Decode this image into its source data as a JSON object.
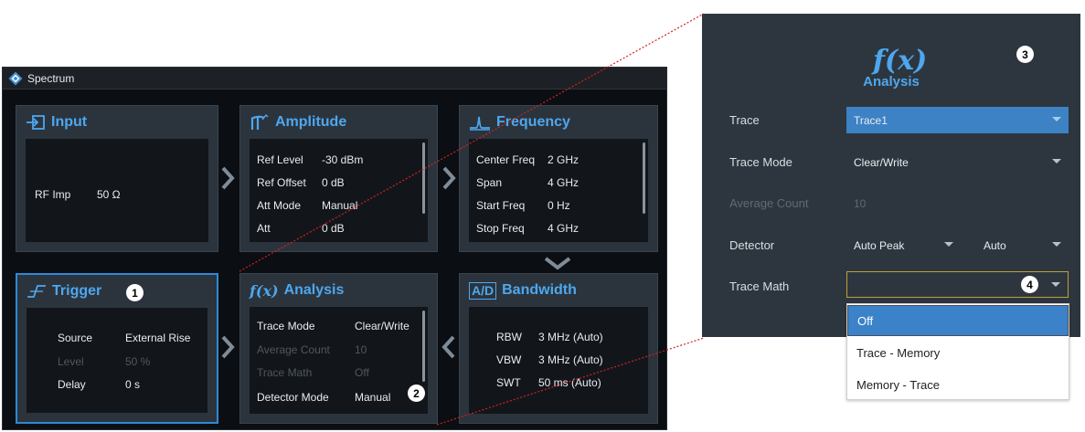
{
  "window": {
    "title": "Spectrum"
  },
  "panels": {
    "input": {
      "title": "Input",
      "rows": [
        {
          "label": "RF Imp",
          "value": "50 Ω"
        }
      ]
    },
    "amplitude": {
      "title": "Amplitude",
      "rows": [
        {
          "label": "Ref Level",
          "value": "-30 dBm"
        },
        {
          "label": "Ref Offset",
          "value": "0 dB"
        },
        {
          "label": "Att Mode",
          "value": "Manual"
        },
        {
          "label": "Att",
          "value": "0 dB"
        }
      ]
    },
    "frequency": {
      "title": "Frequency",
      "rows": [
        {
          "label": "Center Freq",
          "value": "2 GHz"
        },
        {
          "label": "Span",
          "value": "4 GHz"
        },
        {
          "label": "Start Freq",
          "value": "0 Hz"
        },
        {
          "label": "Stop Freq",
          "value": "4 GHz"
        }
      ]
    },
    "trigger": {
      "title": "Trigger",
      "badge": "1",
      "rows": [
        {
          "label": "Source",
          "value": "External Rise"
        },
        {
          "label": "Level",
          "value": "50 %"
        },
        {
          "label": "Delay",
          "value": "0 s"
        }
      ]
    },
    "analysis": {
      "title": "Analysis",
      "icon_text": "f(x)",
      "badge": "2",
      "rows": [
        {
          "label": "Trace Mode",
          "value": "Clear/Write"
        },
        {
          "label": "Average Count",
          "value": "10"
        },
        {
          "label": "Trace Math",
          "value": "Off"
        },
        {
          "label": "Detector Mode",
          "value": "Manual"
        }
      ]
    },
    "bandwidth": {
      "title": "Bandwidth",
      "icon_text": "A/D",
      "rows": [
        {
          "label": "RBW",
          "value": "3 MHz (Auto)"
        },
        {
          "label": "VBW",
          "value": "3 MHz (Auto)"
        },
        {
          "label": "SWT",
          "value": "50 ms (Auto)"
        }
      ]
    }
  },
  "detail": {
    "icon_text": "f(x)",
    "title": "Analysis",
    "badge": "3",
    "fields": {
      "trace": {
        "label": "Trace",
        "value": "Trace1"
      },
      "trace_mode": {
        "label": "Trace Mode",
        "value": "Clear/Write"
      },
      "average_count": {
        "label": "Average Count",
        "value": "10"
      },
      "detector": {
        "label": "Detector",
        "value": "Auto Peak",
        "value2": "Auto"
      },
      "trace_math": {
        "label": "Trace Math",
        "value": "",
        "badge": "4"
      }
    }
  },
  "dropdown": {
    "options": [
      "Off",
      "Trace - Memory",
      "Memory - Trace"
    ],
    "selected": "Off"
  },
  "colors": {
    "accent": "#4ea7ee",
    "panel_bg": "#2b343d",
    "selected_border": "#2e89d6",
    "connector": "#d22222"
  }
}
